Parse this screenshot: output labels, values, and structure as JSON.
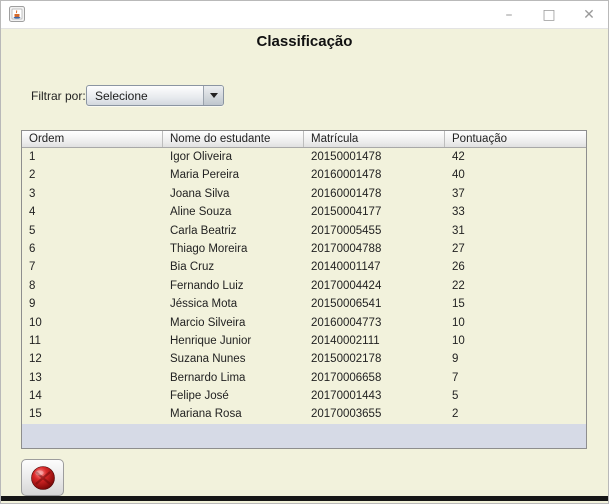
{
  "window": {
    "controls": {
      "minimize": "–",
      "maximize": "□",
      "close": "✕"
    }
  },
  "header": {
    "title": "Classificação"
  },
  "filter": {
    "label": "Filtrar por:",
    "selected_value": "Selecione"
  },
  "table": {
    "columns": [
      "Ordem",
      "Nome do estudante",
      "Matrícula",
      "Pontuação"
    ],
    "rows": [
      [
        "1",
        "Igor Oliveira",
        "20150001478",
        "42"
      ],
      [
        "2",
        "Maria Pereira",
        "20160001478",
        "40"
      ],
      [
        "3",
        "Joana Silva",
        "20160001478",
        "37"
      ],
      [
        "4",
        "Aline Souza",
        "20150004177",
        "33"
      ],
      [
        "5",
        "Carla Beatriz",
        "20170005455",
        "31"
      ],
      [
        "6",
        "Thiago Moreira",
        "20170004788",
        "27"
      ],
      [
        "7",
        "Bia Cruz",
        "20140001147",
        "26"
      ],
      [
        "8",
        "Fernando Luiz",
        "20170004424",
        "22"
      ],
      [
        "9",
        "Jéssica Mota",
        "20150006541",
        "15"
      ],
      [
        "10",
        "Marcio Silveira",
        "20160004773",
        "10"
      ],
      [
        "11",
        "Henrique Junior",
        "20140002111",
        "10"
      ],
      [
        "12",
        "Suzana Nunes",
        "20150002178",
        "9"
      ],
      [
        "13",
        "Bernardo Lima",
        "20170006658",
        "7"
      ],
      [
        "14",
        "Felipe José",
        "20170001443",
        "5"
      ],
      [
        "15",
        "Mariana Rosa",
        "20170003655",
        "2"
      ]
    ]
  },
  "icons": {
    "app_icon": "java-app-icon",
    "exit_icon": "red-orb-icon",
    "dropdown_icon": "chevron-down-icon"
  },
  "colors": {
    "content_background": "#f2f2dc",
    "table_filler": "#d6dae6",
    "orb_red": "#c32020",
    "titlebar": "#ffffff"
  }
}
